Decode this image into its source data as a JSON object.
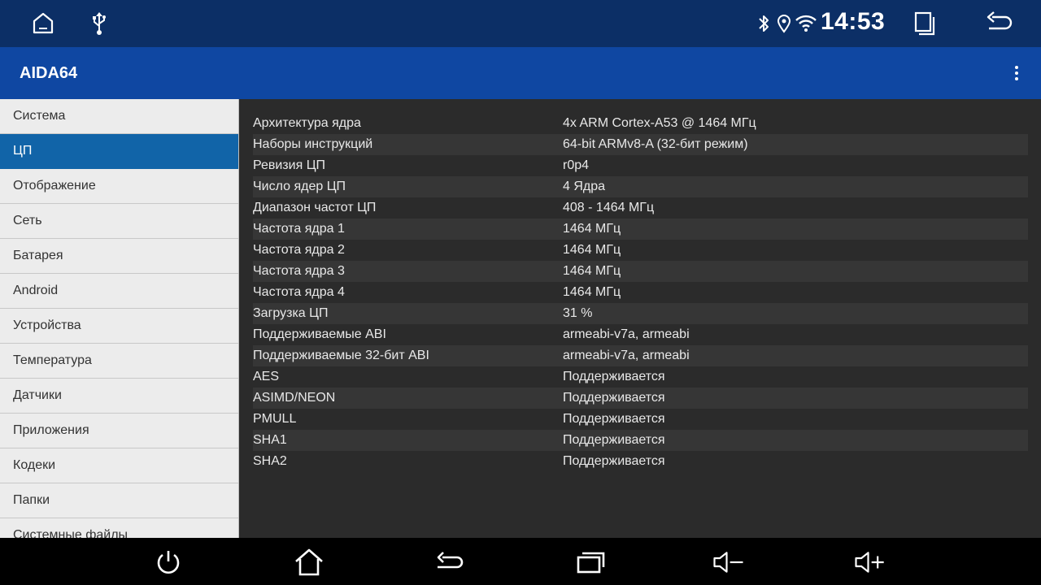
{
  "status_bar": {
    "time": "14:53",
    "left_icons": [
      "home-icon",
      "usb-icon"
    ],
    "right_icons": [
      "bluetooth-icon",
      "location-icon",
      "wifi-icon",
      "recent-apps-icon",
      "back-icon"
    ]
  },
  "app_bar": {
    "title": "AIDA64",
    "menu_icon": "more-vert-icon"
  },
  "sidebar": {
    "items": [
      {
        "label": "Система",
        "active": false
      },
      {
        "label": "ЦП",
        "active": true
      },
      {
        "label": "Отображение",
        "active": false
      },
      {
        "label": "Сеть",
        "active": false
      },
      {
        "label": "Батарея",
        "active": false
      },
      {
        "label": "Android",
        "active": false
      },
      {
        "label": "Устройства",
        "active": false
      },
      {
        "label": "Температура",
        "active": false
      },
      {
        "label": "Датчики",
        "active": false
      },
      {
        "label": "Приложения",
        "active": false
      },
      {
        "label": "Кодеки",
        "active": false
      },
      {
        "label": "Папки",
        "active": false
      },
      {
        "label": "Системные файлы",
        "active": false
      }
    ]
  },
  "cpu_table": {
    "rows": [
      {
        "key": "Архитектура ядра",
        "value": "4x ARM Cortex-A53 @ 1464 МГц"
      },
      {
        "key": "Наборы инструкций",
        "value": "64-bit ARMv8-A (32-бит режим)"
      },
      {
        "key": "Ревизия ЦП",
        "value": "r0p4"
      },
      {
        "key": "Число ядер ЦП",
        "value": "4 Ядра"
      },
      {
        "key": "Диапазон частот ЦП",
        "value": "408 - 1464 МГц"
      },
      {
        "key": "Частота ядра 1",
        "value": "1464 МГц"
      },
      {
        "key": "Частота ядра 2",
        "value": "1464 МГц"
      },
      {
        "key": "Частота ядра 3",
        "value": "1464 МГц"
      },
      {
        "key": "Частота ядра 4",
        "value": "1464 МГц"
      },
      {
        "key": "Загрузка ЦП",
        "value": "31 %"
      },
      {
        "key": "Поддерживаемые ABI",
        "value": "armeabi-v7a, armeabi"
      },
      {
        "key": "Поддерживаемые 32-бит ABI",
        "value": "armeabi-v7a, armeabi"
      },
      {
        "key": "AES",
        "value": "Поддерживается"
      },
      {
        "key": "ASIMD/NEON",
        "value": "Поддерживается"
      },
      {
        "key": "PMULL",
        "value": "Поддерживается"
      },
      {
        "key": "SHA1",
        "value": "Поддерживается"
      },
      {
        "key": "SHA2",
        "value": "Поддерживается"
      }
    ]
  },
  "nav_bar": {
    "buttons": [
      "power-icon",
      "home-icon",
      "back-icon",
      "recent-apps-icon",
      "volume-down-icon",
      "volume-up-icon"
    ]
  },
  "colors": {
    "status_bar": "#0c2f66",
    "app_bar": "#0f47a2",
    "sidebar_active": "#1164a8",
    "content_bg": "#2b2b2b"
  }
}
